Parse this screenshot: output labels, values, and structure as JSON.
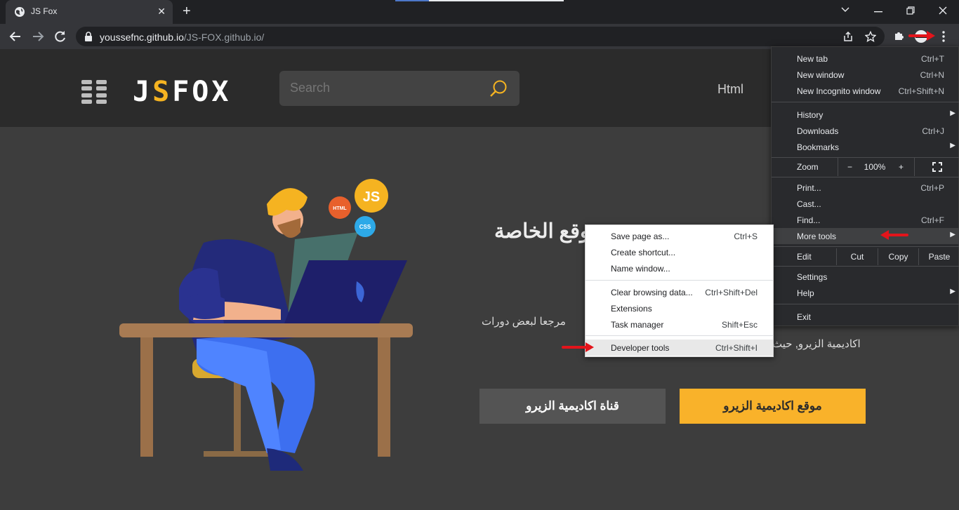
{
  "browser": {
    "tab_title": "JS Fox",
    "tab_close": "✕",
    "new_tab": "+",
    "url_host": "youssefnc.github.io",
    "url_path": "/JS-FOX.github.io/"
  },
  "site": {
    "logo_prefix": "J",
    "logo_fox": "S",
    "logo_suffix": "FOX",
    "search_placeholder": "Search",
    "nav_html": "Html",
    "hero_title": "بموقع الخاصة",
    "hero_p1": "مرجعا لبعض دورات",
    "hero_p2": "اكاديمية الزيرو, حيث",
    "btn_channel": "قناة اكاديمية الزيرو",
    "btn_site": "موقع اكاديمية الزيرو",
    "badges": {
      "js": "JS",
      "html": "HTML",
      "css": "CSS"
    }
  },
  "menu": {
    "new_tab": {
      "label": "New tab",
      "shortcut": "Ctrl+T"
    },
    "new_window": {
      "label": "New window",
      "shortcut": "Ctrl+N"
    },
    "incognito": {
      "label": "New Incognito window",
      "shortcut": "Ctrl+Shift+N"
    },
    "history": {
      "label": "History"
    },
    "downloads": {
      "label": "Downloads",
      "shortcut": "Ctrl+J"
    },
    "bookmarks": {
      "label": "Bookmarks"
    },
    "zoom": {
      "label": "Zoom",
      "minus": "−",
      "value": "100%",
      "plus": "+"
    },
    "print": {
      "label": "Print...",
      "shortcut": "Ctrl+P"
    },
    "cast": {
      "label": "Cast..."
    },
    "find": {
      "label": "Find...",
      "shortcut": "Ctrl+F"
    },
    "more_tools": {
      "label": "More tools"
    },
    "edit": {
      "label": "Edit",
      "cut": "Cut",
      "copy": "Copy",
      "paste": "Paste"
    },
    "settings": {
      "label": "Settings"
    },
    "help": {
      "label": "Help"
    },
    "exit": {
      "label": "Exit"
    }
  },
  "submenu": {
    "save_page": {
      "label": "Save page as...",
      "shortcut": "Ctrl+S"
    },
    "create_shortcut": {
      "label": "Create shortcut..."
    },
    "name_window": {
      "label": "Name window..."
    },
    "clear_data": {
      "label": "Clear browsing data...",
      "shortcut": "Ctrl+Shift+Del"
    },
    "extensions": {
      "label": "Extensions"
    },
    "task_manager": {
      "label": "Task manager",
      "shortcut": "Shift+Esc"
    },
    "dev_tools": {
      "label": "Developer tools",
      "shortcut": "Ctrl+Shift+I"
    }
  },
  "colors": {
    "accent_yellow": "#f9b22a",
    "annotation_red": "#e3141b",
    "chrome_dark": "#292a2d"
  }
}
